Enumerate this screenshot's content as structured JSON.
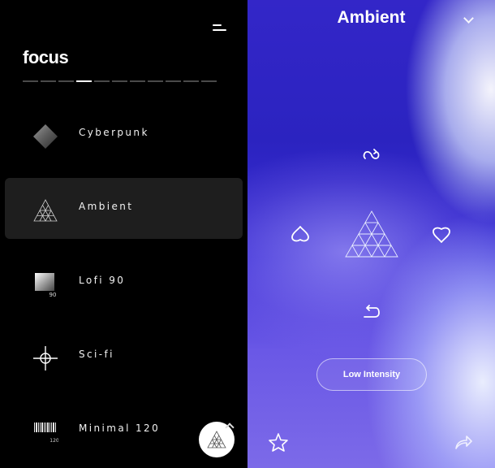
{
  "left": {
    "brand": "focus",
    "progress": {
      "segments": 11,
      "active_index": 3
    },
    "items": [
      {
        "label": "Cyberpunk",
        "icon": "diamond-icon",
        "selected": false
      },
      {
        "label": "Ambient",
        "icon": "pyramid-mesh-icon",
        "selected": true
      },
      {
        "label": "Lofi 90",
        "icon": "lofi-noise-icon",
        "icon_caption": "90",
        "selected": false
      },
      {
        "label": "Sci-fi",
        "icon": "crosshair-icon",
        "selected": false
      },
      {
        "label": "Minimal 120",
        "icon": "barcode-icon",
        "icon_caption": "120",
        "selected": false
      }
    ]
  },
  "right": {
    "title": "Ambient",
    "intensity_label": "Low Intensity"
  },
  "colors": {
    "bg_left": "#000000",
    "accent_blue": "#2b23c0",
    "selected_row": "#1e1e1e"
  }
}
